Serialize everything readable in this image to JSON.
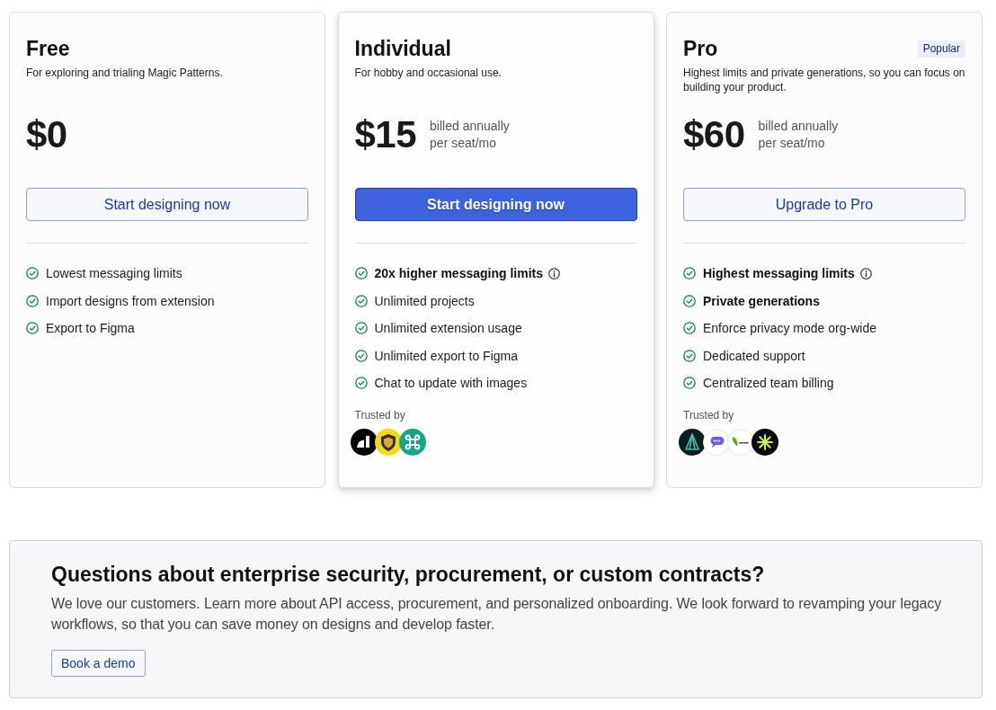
{
  "plans": [
    {
      "name": "Free",
      "description": "For exploring and trialing Magic Patterns.",
      "highlighted": false,
      "price": "$0",
      "button": {
        "label": "Start designing now",
        "kind": "outline"
      },
      "features": [
        {
          "text": "Lowest messaging limits",
          "bold": false,
          "info": false
        },
        {
          "text": "Import designs from extension",
          "bold": false,
          "info": false
        },
        {
          "text": "Export to Figma",
          "bold": false,
          "info": false
        }
      ]
    },
    {
      "name": "Individual",
      "description": "For hobby and occasional use.",
      "highlighted": true,
      "price": "$15",
      "billing": [
        "billed annually",
        "per seat/mo"
      ],
      "button": {
        "label": "Start designing now",
        "kind": "primary"
      },
      "features": [
        {
          "text": "20x higher messaging limits",
          "bold": true,
          "info": true
        },
        {
          "text": "Unlimited projects",
          "bold": false,
          "info": false
        },
        {
          "text": "Unlimited extension usage",
          "bold": false,
          "info": false
        },
        {
          "text": "Unlimited export to Figma",
          "bold": false,
          "info": false
        },
        {
          "text": "Chat to update with images",
          "bold": false,
          "info": false
        }
      ],
      "trusted_by": {
        "label": "Trusted by",
        "logos": [
          {
            "kind": "halfmoon"
          },
          {
            "kind": "shield"
          },
          {
            "kind": "command"
          }
        ]
      }
    },
    {
      "name": "Pro",
      "badge": "Popular",
      "description": "Highest limits and private generations, so you can focus on building your product.",
      "highlighted": false,
      "price": "$60",
      "billing": [
        "billed annually",
        "per seat/mo"
      ],
      "button": {
        "label": "Upgrade to Pro",
        "kind": "outline"
      },
      "features": [
        {
          "text": "Highest messaging limits",
          "bold": true,
          "info": true
        },
        {
          "text": "Private generations",
          "bold": true,
          "info": false
        },
        {
          "text": "Enforce privacy mode org-wide",
          "bold": false,
          "info": false
        },
        {
          "text": "Dedicated support",
          "bold": false,
          "info": false
        },
        {
          "text": "Centralized team billing",
          "bold": false,
          "info": false
        }
      ],
      "trusted_by": {
        "label": "Trusted by",
        "logos": [
          {
            "kind": "peak"
          },
          {
            "kind": "chat"
          },
          {
            "kind": "leaf"
          },
          {
            "kind": "asterisk"
          }
        ]
      }
    }
  ],
  "enterprise": {
    "title": "Questions about enterprise security, procurement, or custom contracts?",
    "text": "We love our customers. Learn more about API access, procurement, and personalized onboarding. We look forward to revamping your legacy workflows, so that you can save money on designs and develop faster.",
    "button": "Book a demo"
  }
}
